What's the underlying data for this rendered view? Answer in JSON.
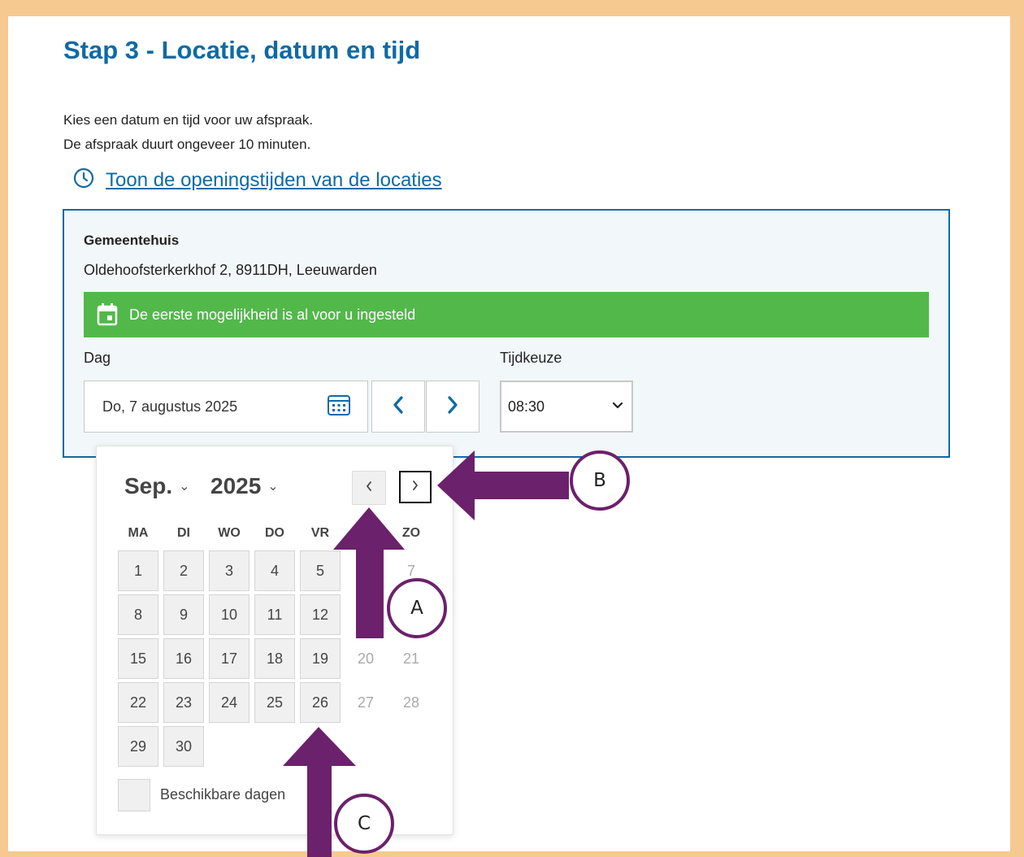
{
  "page": {
    "title": "Stap 3 - Locatie, datum en tijd",
    "intro_line1": "Kies een datum en tijd voor uw afspraak.",
    "intro_line2": "De afspraak duurt ongeveer 10 minuten.",
    "hours_link": "Toon de openingstijden van de locaties"
  },
  "location": {
    "name": "Gemeentehuis",
    "address": "Oldehoofsterkerkhof 2, 8911DH, Leeuwarden",
    "banner": "De eerste mogelijkheid is al voor u ingesteld"
  },
  "form": {
    "day_label": "Dag",
    "day_value": "Do, 7 augustus 2025",
    "time_label": "Tijdkeuze",
    "time_value": "08:30"
  },
  "calendar": {
    "month": "Sep.",
    "year": "2025",
    "weekdays": [
      "MA",
      "DI",
      "WO",
      "DO",
      "VR",
      "",
      "ZO"
    ],
    "days": [
      "1",
      "2",
      "3",
      "4",
      "5",
      "",
      "7",
      "8",
      "9",
      "10",
      "11",
      "12",
      "",
      "",
      "15",
      "16",
      "17",
      "18",
      "19",
      "20",
      "21",
      "22",
      "23",
      "24",
      "25",
      "26",
      "27",
      "28",
      "29",
      "30"
    ],
    "legend": "Beschikbare dagen"
  },
  "annotations": {
    "a": "A",
    "b": "B",
    "c": "C"
  },
  "colors": {
    "heading": "#0f6aa5",
    "banner": "#52b84a",
    "annotation_arrow": "#6b216b",
    "frame": "#f6c991"
  }
}
